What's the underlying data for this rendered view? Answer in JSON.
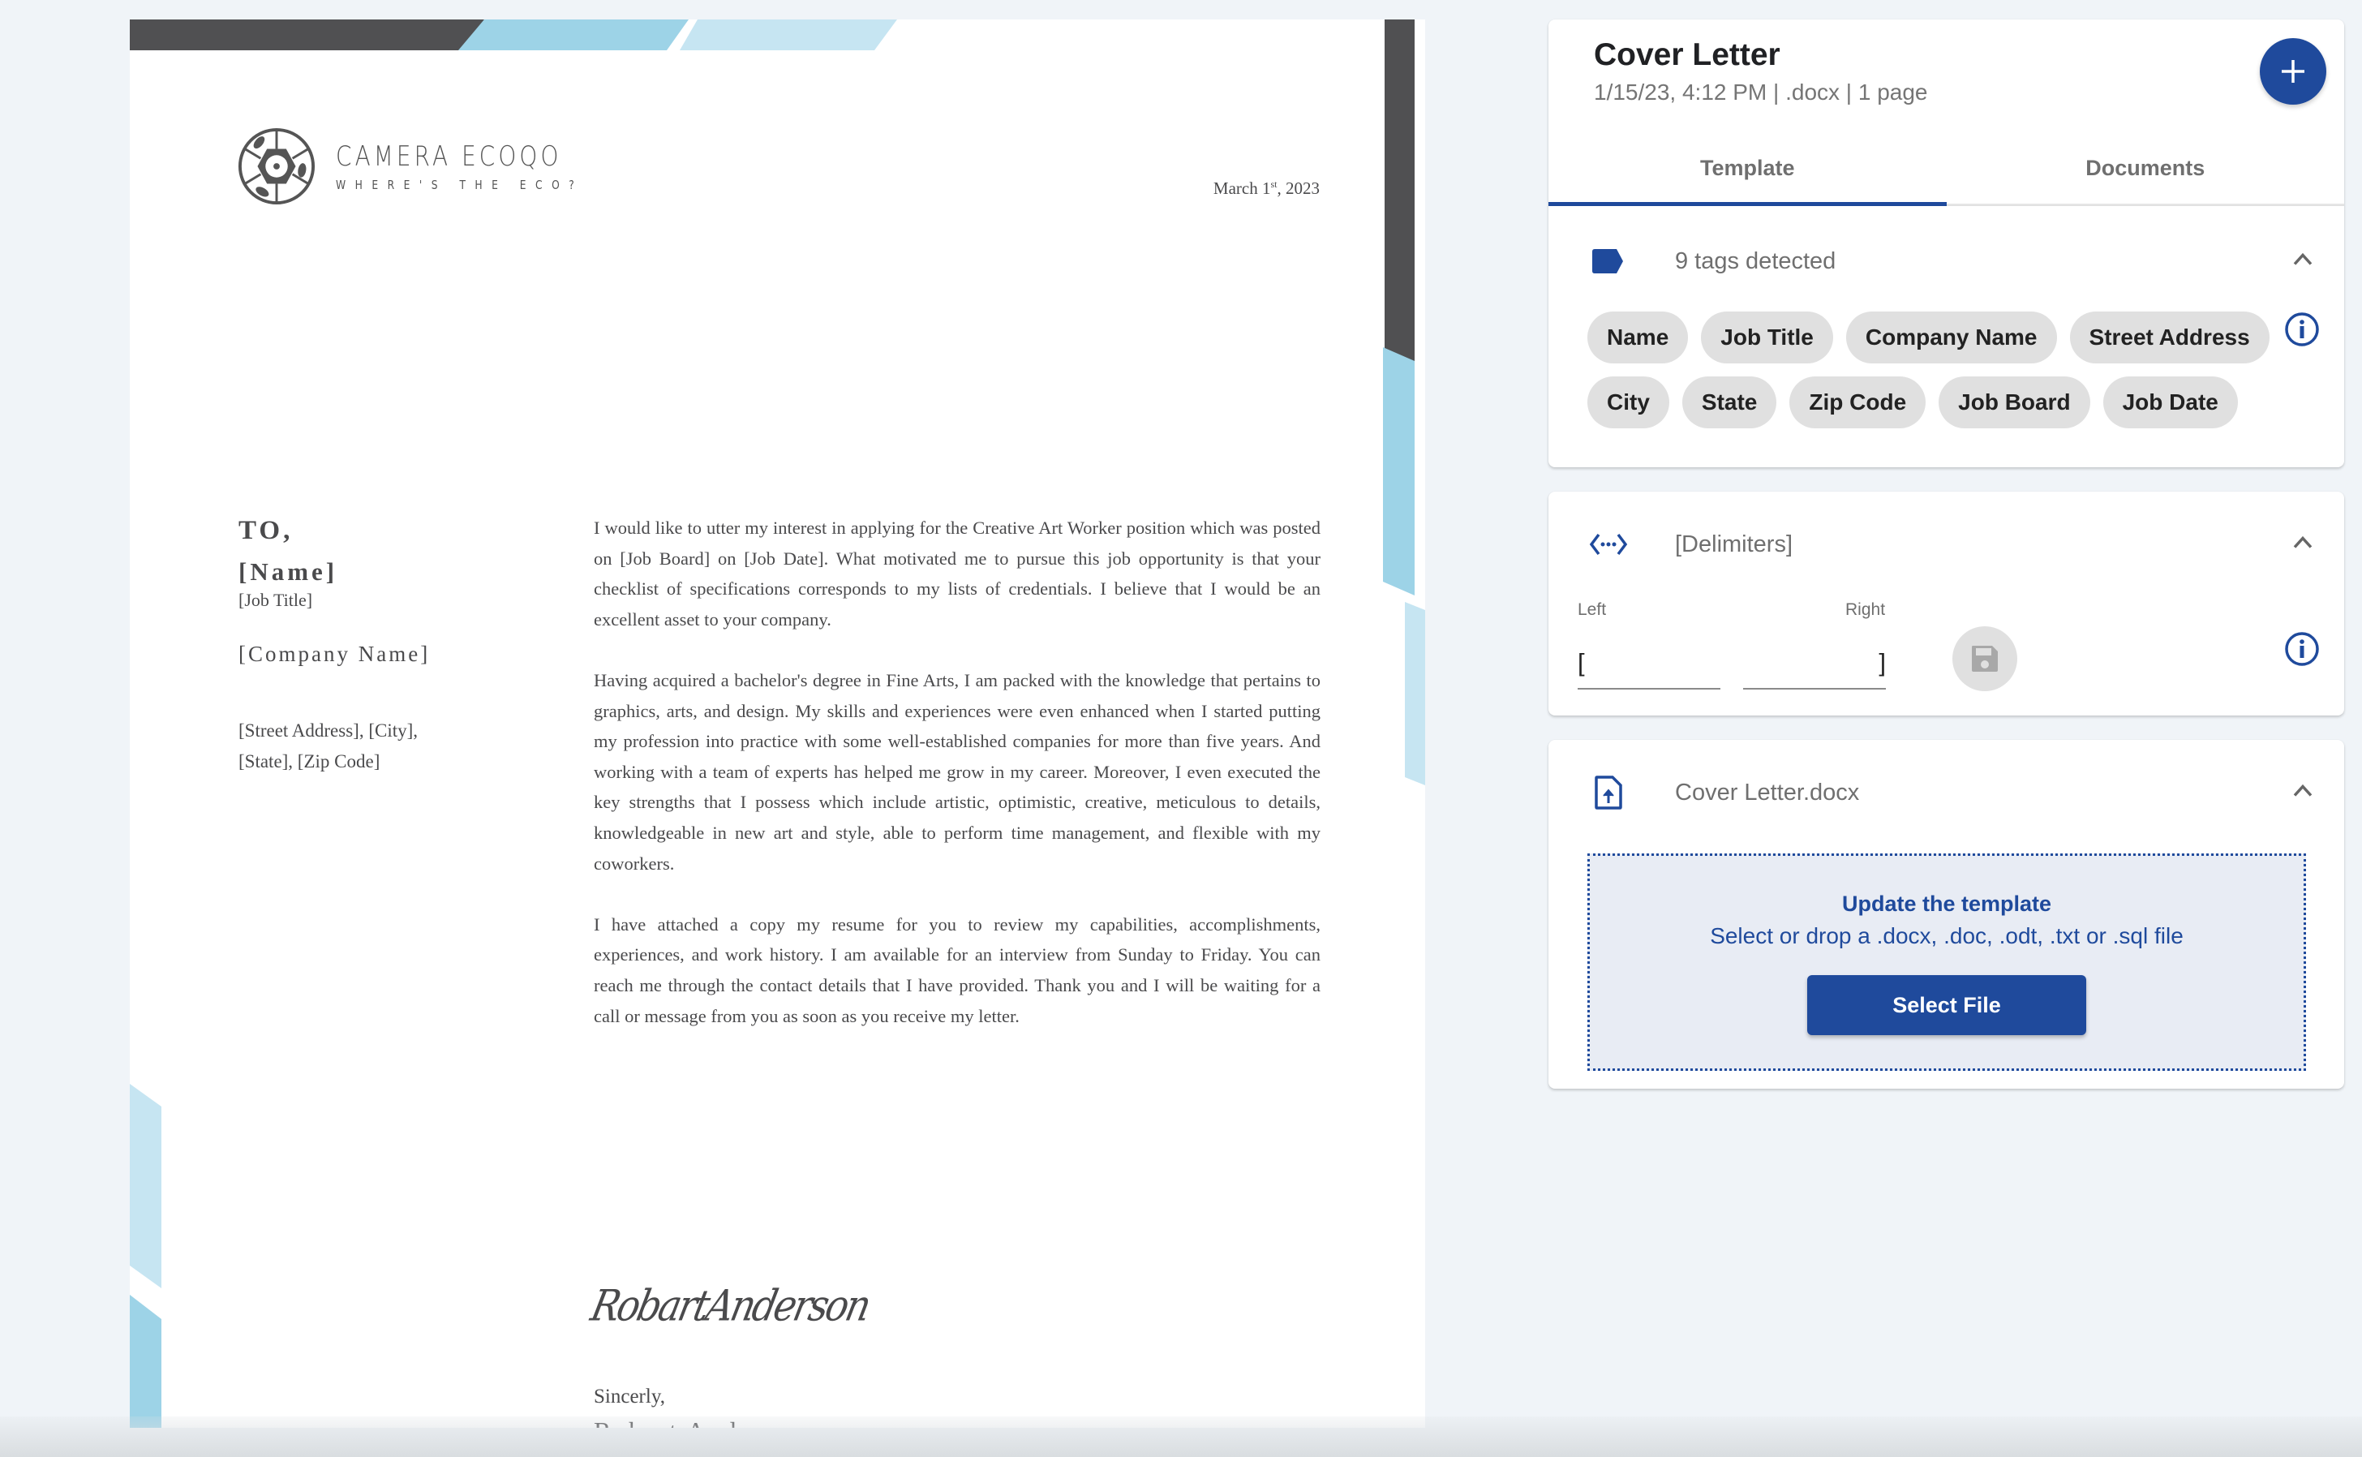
{
  "letter": {
    "logo": {
      "name": "CAMERA ECOQO",
      "tagline": "WHERE'S THE ECO?"
    },
    "date": {
      "prefix": "March 1",
      "sup": "st",
      "suffix": ", 2023"
    },
    "recipient": {
      "to_label": "TO,",
      "name": "[Name]",
      "job_title": "[Job Title]",
      "company": "[Company Name]",
      "address_line1": "[Street Address], [City],",
      "address_line2": "[State], [Zip Code]"
    },
    "paragraphs": [
      "I would like to utter my interest in applying for the Creative Art Worker position which was posted on [Job Board] on [Job Date]. What motivated me to pursue this job opportunity is that your checklist of specifications corresponds to my lists of credentials. I believe that I would be an excellent asset to your company.",
      "Having acquired a bachelor's degree in Fine Arts, I am packed with the knowledge that pertains to graphics, arts, and design. My skills and experiences were even enhanced when I started putting my profession into practice with some well-established companies for more than five years. And working with a team of experts has helped me grow in my career. Moreover, I even executed the key strengths that I possess which include artistic, optimistic, creative, meticulous to details, knowledgeable in new art and style, able to perform time management, and flexible with my coworkers.",
      "I have attached a copy my resume for you to review my capabilities, accomplishments, experiences, and work history. I am available for an interview from Sunday to Friday. You can reach me through the contact details that I have provided. Thank you and I will be waiting for a call or message from you as soon as you receive my letter."
    ],
    "signature": "RobartAnderson",
    "closing": "Sincerly,",
    "sender": "Robart Anderson"
  },
  "panel": {
    "title": "Cover Letter",
    "meta": "1/15/23, 4:12 PM | .docx | 1 page",
    "add_button_icon": "plus-icon",
    "tabs": [
      {
        "label": "Template",
        "active": true
      },
      {
        "label": "Documents",
        "active": false
      }
    ],
    "tags": {
      "icon": "label-icon",
      "title": "9 tags detected",
      "items": [
        "Name",
        "Job Title",
        "Company Name",
        "Street Address",
        "City",
        "State",
        "Zip Code",
        "Job Board",
        "Job Date"
      ]
    },
    "delimiters": {
      "icon": "code-dots-icon",
      "title": "[Delimiters]",
      "left_label": "Left",
      "left_value": "[",
      "right_label": "Right",
      "right_value": "]"
    },
    "file": {
      "icon": "file-upload-icon",
      "title": "Cover Letter.docx",
      "dropzone_title": "Update the template",
      "dropzone_subtitle": "Select or drop a .docx, .doc, .odt, .txt or .sql file",
      "select_button": "Select File"
    }
  },
  "colors": {
    "accent": "#1f4a9c",
    "dark_band": "#505052",
    "light_blue": "#9dd3e7",
    "pale_blue": "#c6e5f2",
    "chip_bg": "#e0e0e0",
    "page_bg": "#f0f4f8"
  }
}
